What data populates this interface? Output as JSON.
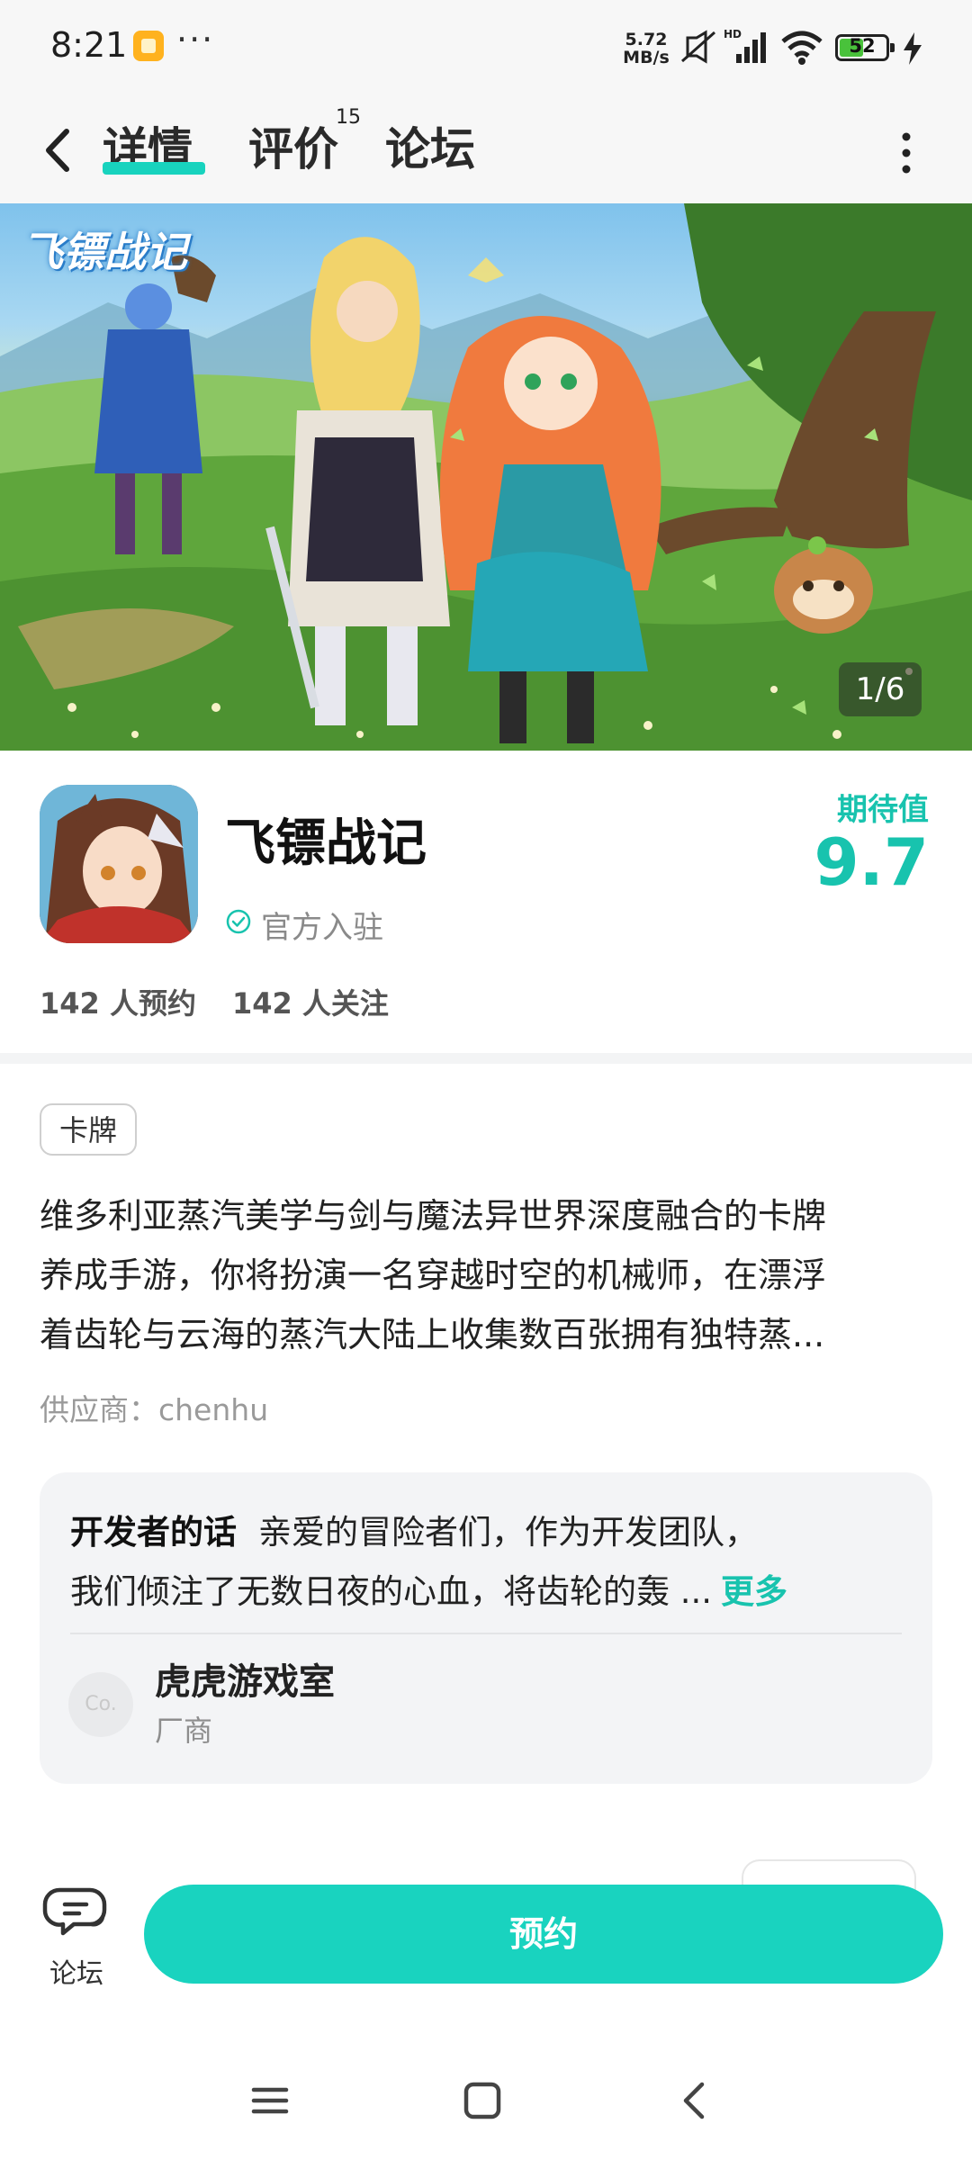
{
  "status_bar": {
    "time": "8:21",
    "net_speed_value": "5.72",
    "net_speed_unit": "MB/s",
    "hd_label": "HD",
    "battery_level": "52",
    "battery_fraction": 0.52,
    "icons": [
      "notification-app-icon",
      "more-dots-icon",
      "mute-vibrate-icon",
      "signal-icon",
      "wifi-icon",
      "battery-icon",
      "charging-icon"
    ]
  },
  "header": {
    "tabs": [
      {
        "label": "详情",
        "active": true
      },
      {
        "label": "评价",
        "badge": "15"
      },
      {
        "label": "论坛"
      }
    ],
    "icons": [
      "back-icon",
      "more-vertical-icon"
    ]
  },
  "hero": {
    "logo_text": "飞镖战记",
    "counter": "1/6"
  },
  "app": {
    "name": "飞镖战记",
    "official_label": "官方入驻",
    "score_label": "期待值",
    "score_value": "9.7",
    "reservations": "142 人预约",
    "followers": "142 人关注"
  },
  "tag": "卡牌",
  "description": {
    "lines": [
      "维多利亚蒸汽美学与剑与魔法异世界深度融合的卡牌",
      "养成手游，你将扮演一名穿越时空的机械师，在漂浮",
      "着齿轮与云海的蒸汽大陆上收集数百张拥有独特蒸..."
    ]
  },
  "supplier": "供应商：chenhu",
  "developer": {
    "title": "开发者的话",
    "line1": "亲爱的冒险者们，作为开发团队，",
    "line2": "我们倾注了无数日夜的心血，将齿轮的轰 ...",
    "more": "更多",
    "avatar_text": "Co.",
    "studio_name": "虎虎游戏室",
    "studio_role": "厂商"
  },
  "bottom": {
    "forum_label": "论坛",
    "reserve_label": "预约"
  },
  "colors": {
    "accent": "#19d3bf",
    "accent_text": "#18c3ae",
    "card_bg": "#f3f4f6",
    "status_bg": "#f7f7f7"
  }
}
